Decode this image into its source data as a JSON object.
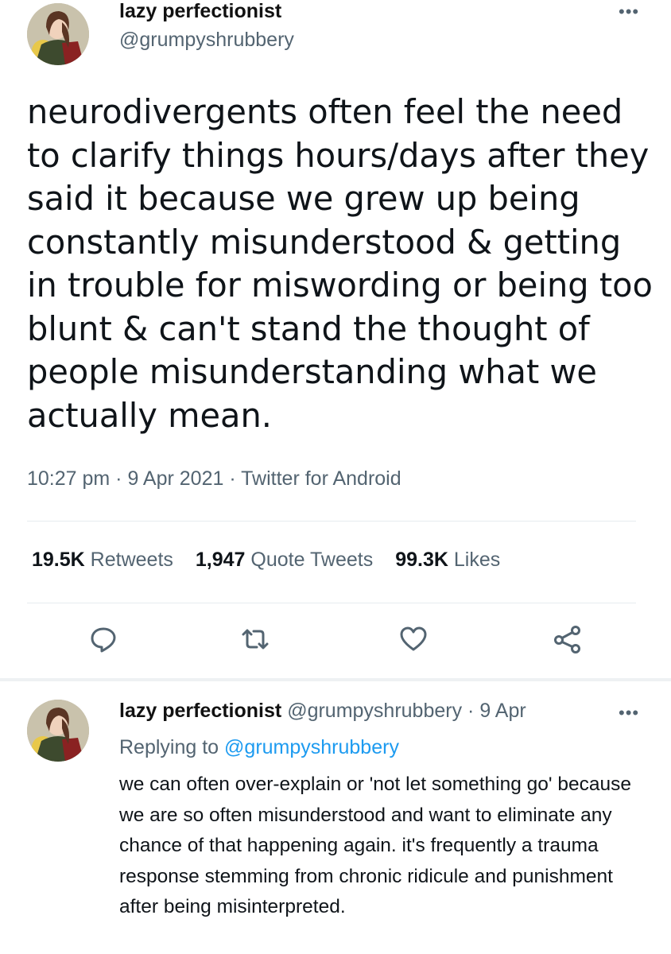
{
  "main_tweet": {
    "display_name": "lazy perfectionist",
    "handle": "@grumpyshrubbery",
    "text": "neurodivergents often feel the need to clarify things hours/days after they said it because we grew up being constantly misunderstood & getting in trouble for miswording or being too blunt & can't stand the thought of people misunderstanding what we actually mean.",
    "meta": "10:27 pm · 9 Apr 2021 · Twitter for Android",
    "stats": {
      "retweets_count": "19.5K",
      "retweets_label": "Retweets",
      "quotes_count": "1,947",
      "quotes_label": "Quote Tweets",
      "likes_count": "99.3K",
      "likes_label": "Likes"
    },
    "more_icon": "more-options-icon"
  },
  "actions": [
    "reply-icon",
    "retweet-icon",
    "like-icon",
    "share-icon"
  ],
  "reply_tweet": {
    "display_name": "lazy perfectionist",
    "handle_date": "@grumpyshrubbery · 9 Apr",
    "replying_prefix": "Replying to",
    "replying_handle": "@grumpyshrubbery",
    "text": "we can often over-explain or 'not let something go' because we are so often misunderstood and want to eliminate any chance of that happening again. it's frequently a trauma response stemming from chronic ridicule and punishment after being misinterpreted."
  },
  "colors": {
    "text": "#0f1419",
    "secondary": "#536471",
    "link": "#1d9bf0",
    "divider": "#e6ecf0"
  }
}
